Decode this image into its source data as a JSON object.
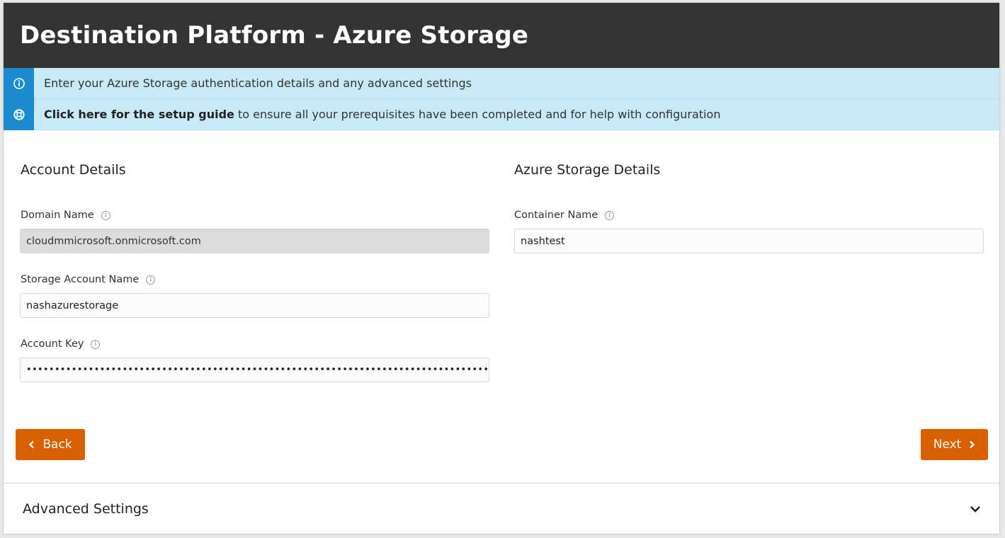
{
  "header": {
    "title": "Destination Platform - Azure Storage"
  },
  "info": {
    "message": "Enter your Azure Storage authentication details and any advanced settings",
    "guide_link": "Click here for the setup guide",
    "guide_rest": " to ensure all your prerequisites have been completed and for help with configuration",
    "icons": {
      "info": "info-circle-icon",
      "guide": "life-ring-icon"
    }
  },
  "account": {
    "title": "Account Details",
    "domain_label": "Domain Name",
    "domain_value": "cloudmmicrosoft.onmicrosoft.com",
    "storage_label": "Storage Account Name",
    "storage_value": "nashazurestorage",
    "key_label": "Account Key",
    "key_value": "•••••••••••••••••••••••••••••••••••••••••••••••••••••••••••••••••••••••••••••••••••••••••••"
  },
  "azure": {
    "title": "Azure Storage Details",
    "container_label": "Container Name",
    "container_value": "nashtest"
  },
  "buttons": {
    "back": "Back",
    "next": "Next"
  },
  "advanced": {
    "title": "Advanced Settings"
  },
  "colors": {
    "header_bg": "#333333",
    "info_bg": "#c8e9f7",
    "info_badge": "#1a8ccf",
    "button": "#d96000"
  }
}
